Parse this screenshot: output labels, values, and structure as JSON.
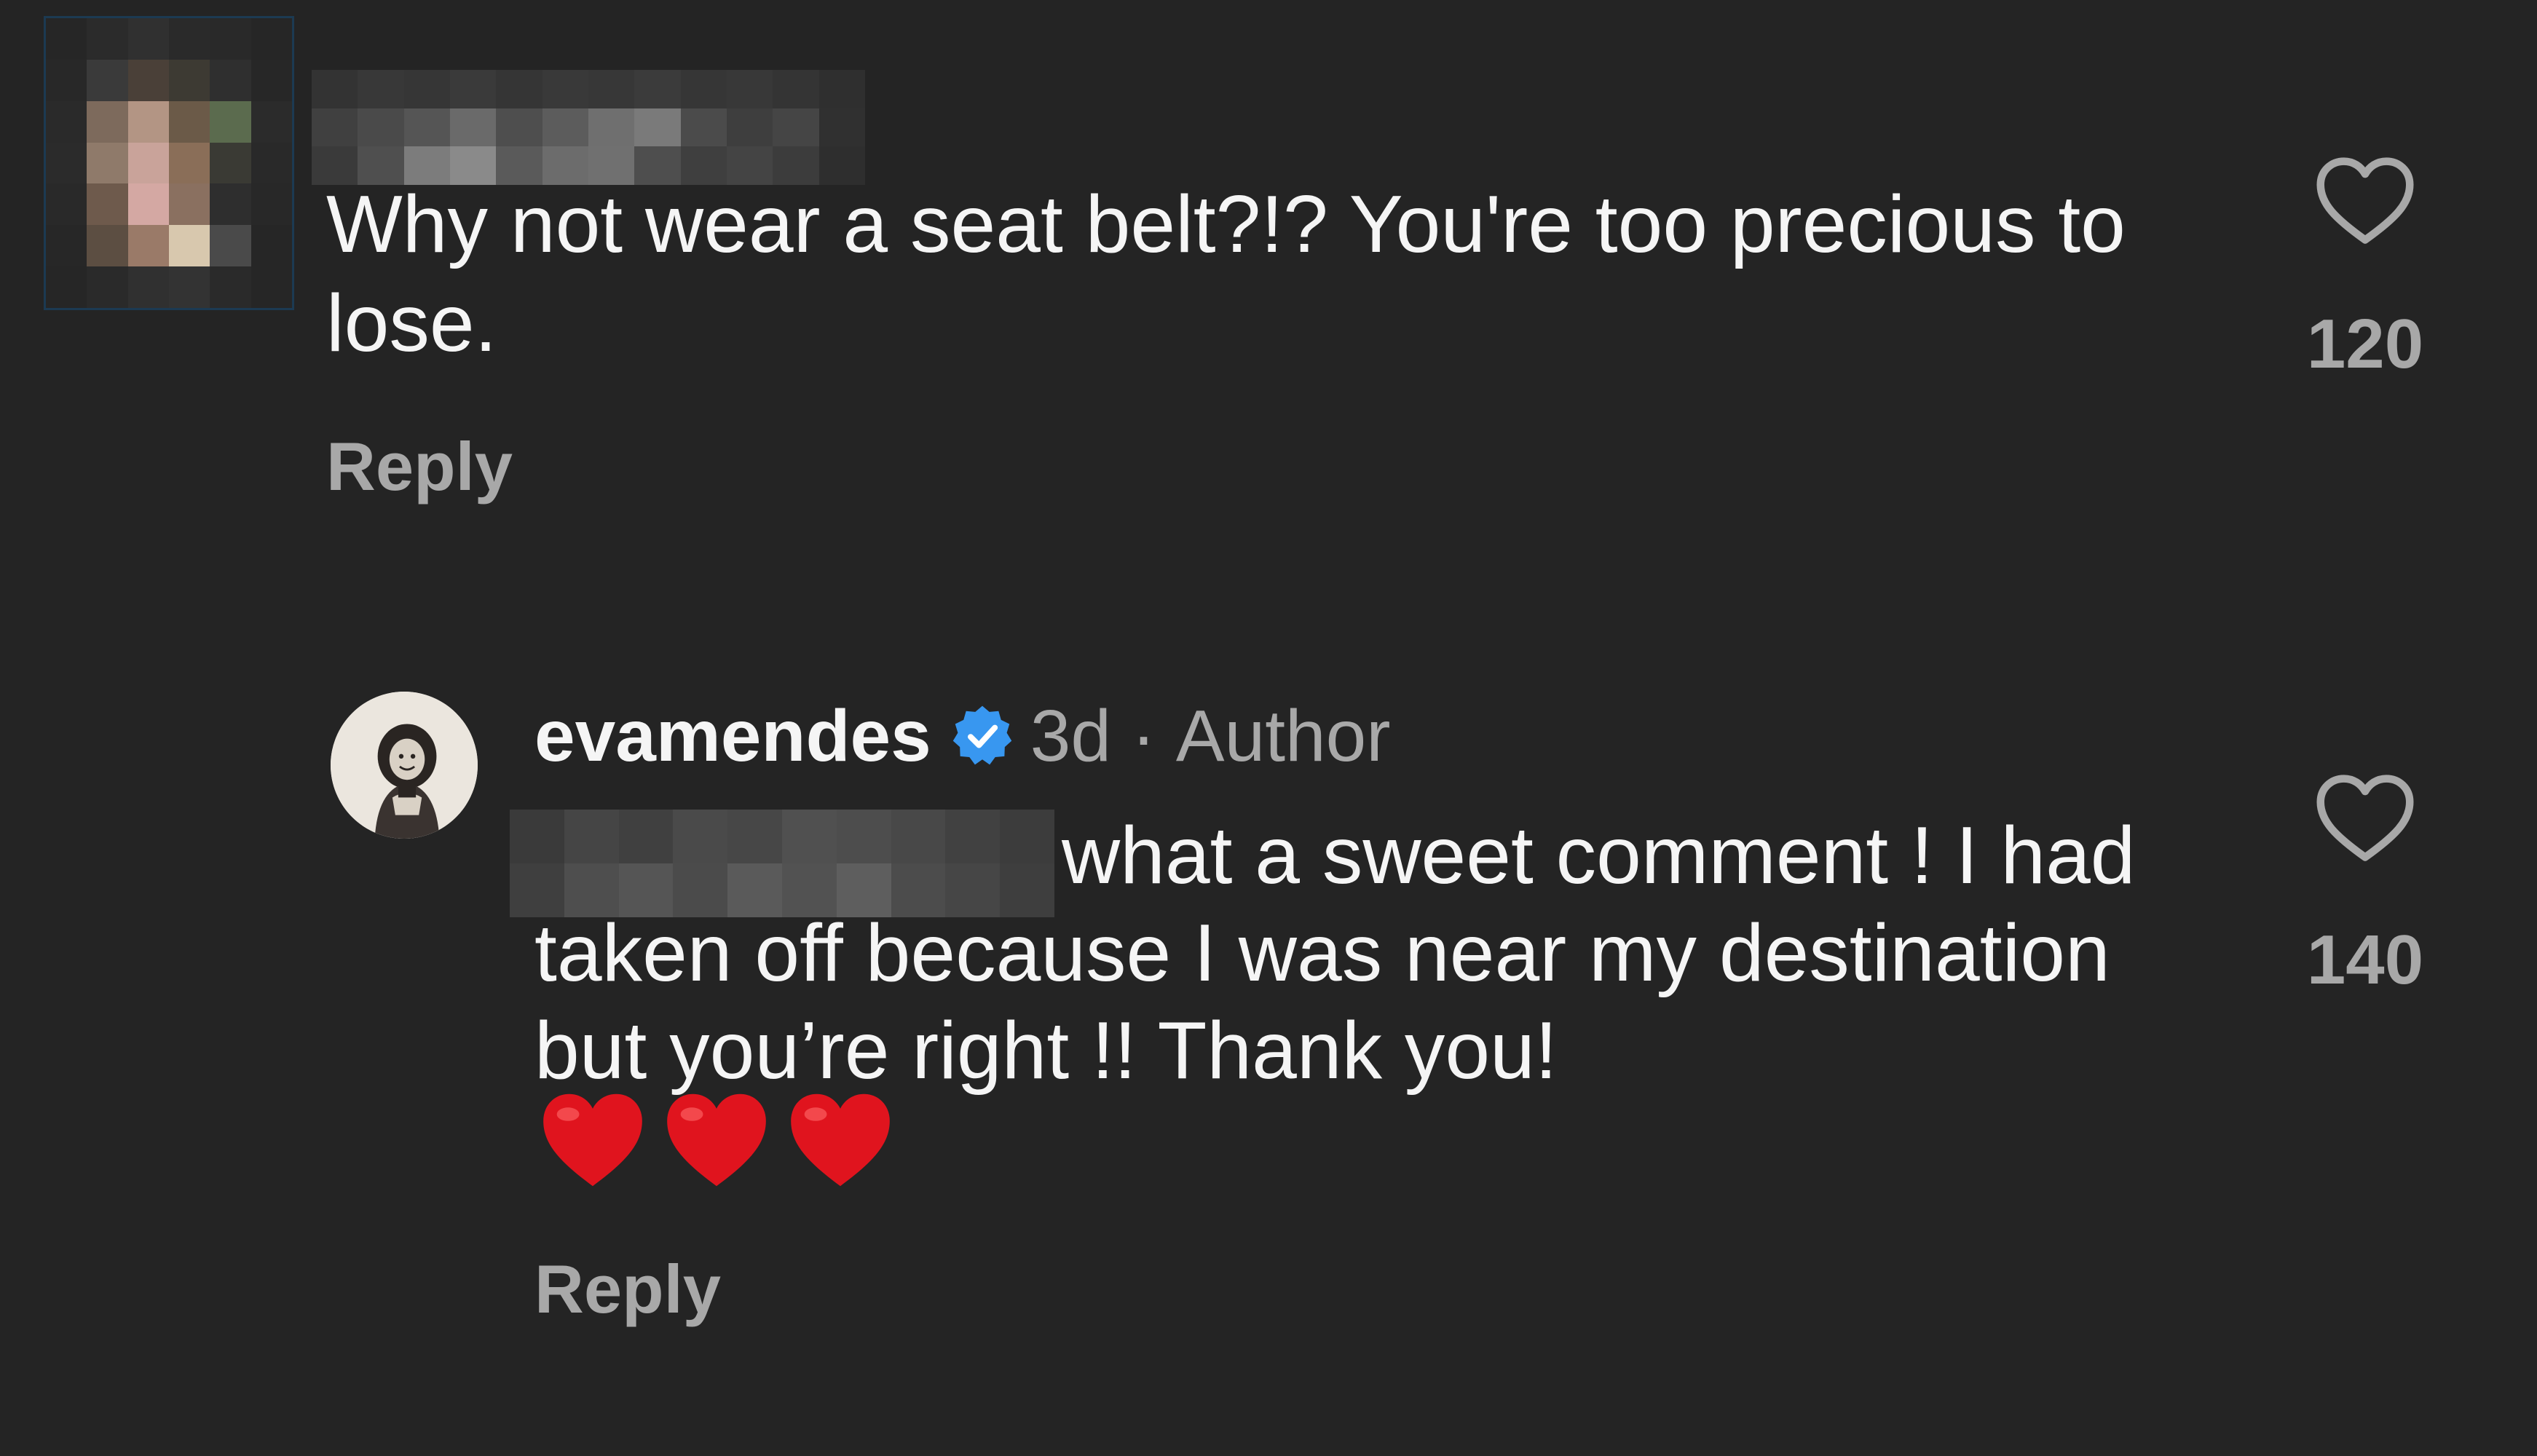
{
  "colors": {
    "background": "#242424",
    "text_primary": "#f5f5f5",
    "text_secondary": "#a8a8a8",
    "verified_badge": "#3897f0",
    "emoji_heart": "#e0141e"
  },
  "comments": [
    {
      "username_redacted": true,
      "avatar_redacted": true,
      "text": "Why not wear a seat belt?!? You're too precious to lose.",
      "reply_label": "Reply",
      "like_icon": "heart-outline-icon",
      "like_count": "120"
    },
    {
      "username": "evamendes",
      "verified": true,
      "verified_icon": "verified-badge-icon",
      "time": "3d",
      "separator": "·",
      "role": "Author",
      "mention_redacted": true,
      "text": "what a sweet comment ! I had taken off because I was near my destination but you’re right !! Thank you!",
      "emoji": [
        "❤️",
        "❤️",
        "❤️"
      ],
      "reply_label": "Reply",
      "like_icon": "heart-outline-icon",
      "like_count": "140"
    }
  ]
}
